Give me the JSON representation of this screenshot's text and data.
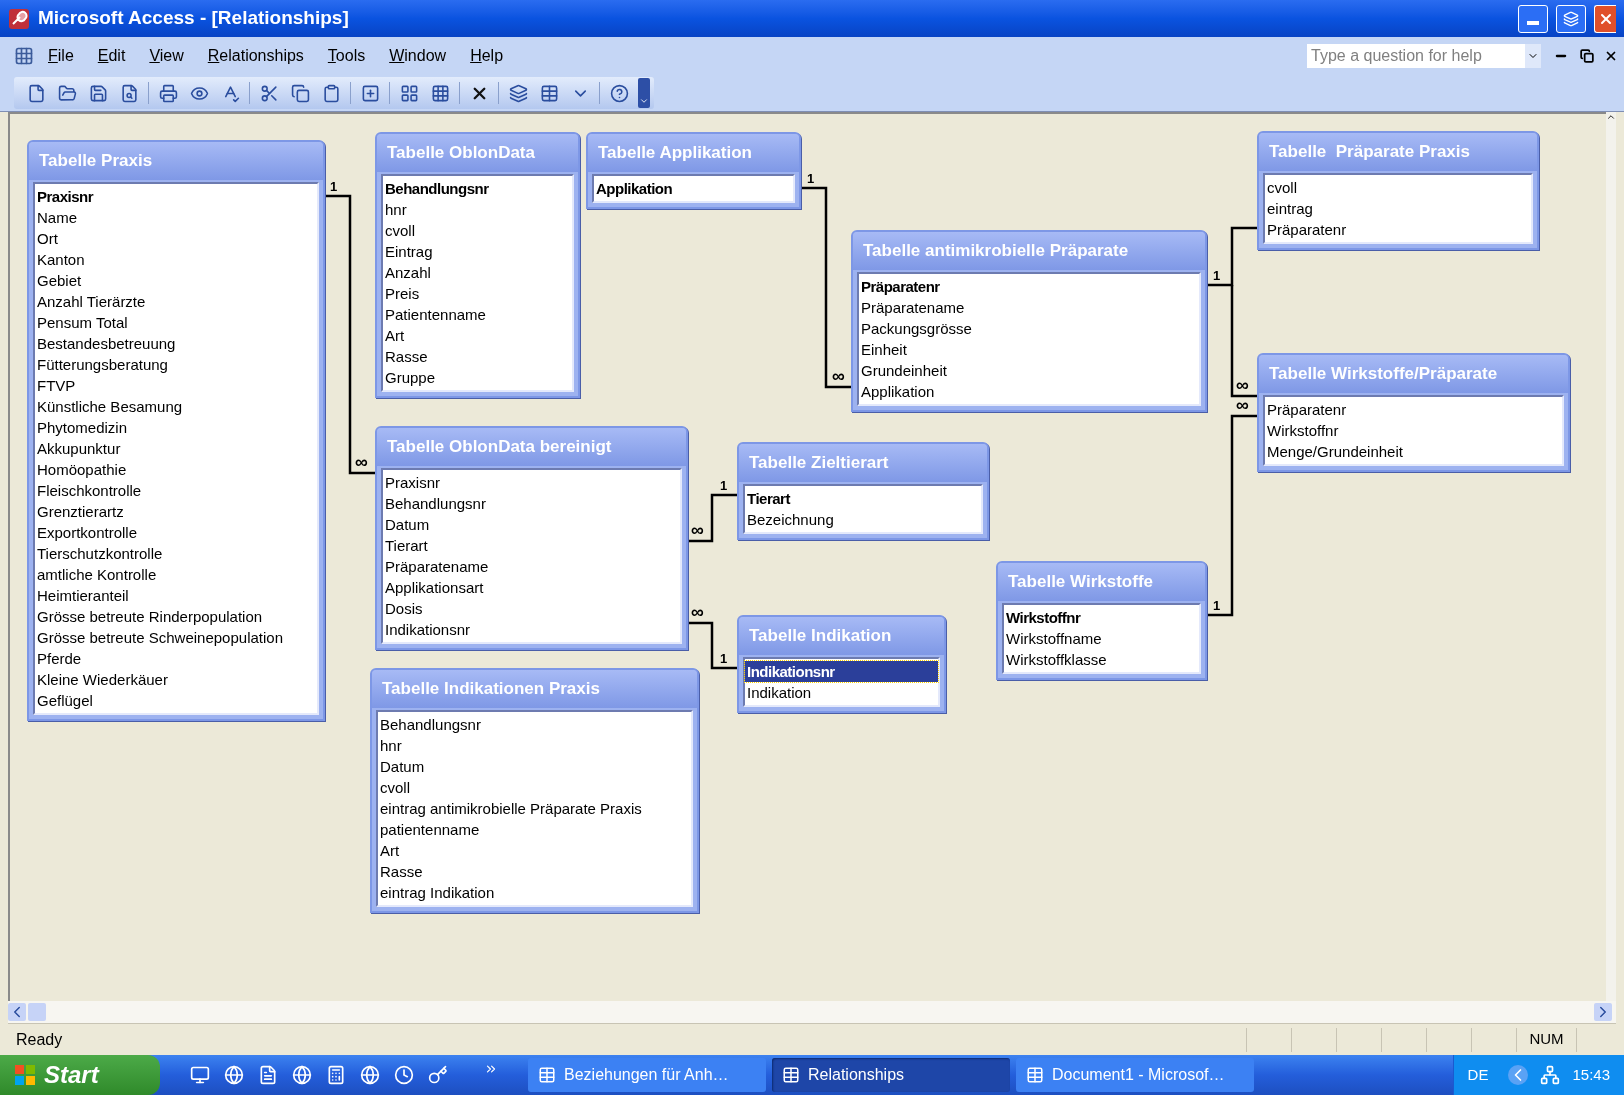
{
  "window": {
    "title": "Microsoft Access - [Relationships]"
  },
  "menu": [
    {
      "label": "File"
    },
    {
      "label": "Edit"
    },
    {
      "label": "View"
    },
    {
      "label": "Relationships"
    },
    {
      "label": "Tools"
    },
    {
      "label": "Window"
    },
    {
      "label": "Help"
    }
  ],
  "help_box": {
    "placeholder": "Type a question for help"
  },
  "tables": [
    {
      "title": "Tabelle Praxis",
      "fields": [
        {
          "name": "Praxisnr",
          "key": true,
          "selected": false
        },
        {
          "name": "Name",
          "key": false,
          "selected": false
        },
        {
          "name": "Ort",
          "key": false,
          "selected": false
        },
        {
          "name": "Kanton",
          "key": false,
          "selected": false
        },
        {
          "name": "Gebiet",
          "key": false,
          "selected": false
        },
        {
          "name": "Anzahl Tierärzte",
          "key": false,
          "selected": false
        },
        {
          "name": "Pensum Total",
          "key": false,
          "selected": false
        },
        {
          "name": "Bestandesbetreuung",
          "key": false,
          "selected": false
        },
        {
          "name": "Fütterungsberatung",
          "key": false,
          "selected": false
        },
        {
          "name": "FTVP",
          "key": false,
          "selected": false
        },
        {
          "name": "Künstliche Besamung",
          "key": false,
          "selected": false
        },
        {
          "name": "Phytomedizin",
          "key": false,
          "selected": false
        },
        {
          "name": "Akkupunktur",
          "key": false,
          "selected": false
        },
        {
          "name": "Homöopathie",
          "key": false,
          "selected": false
        },
        {
          "name": "Fleischkontrolle",
          "key": false,
          "selected": false
        },
        {
          "name": "Grenztierartz",
          "key": false,
          "selected": false
        },
        {
          "name": "Exportkontrolle",
          "key": false,
          "selected": false
        },
        {
          "name": "Tierschutzkontrolle",
          "key": false,
          "selected": false
        },
        {
          "name": "amtliche Kontrolle",
          "key": false,
          "selected": false
        },
        {
          "name": "Heimtieranteil",
          "key": false,
          "selected": false
        },
        {
          "name": "Grösse betreute Rinderpopulation",
          "key": false,
          "selected": false
        },
        {
          "name": "Grösse betreute Schweinepopulation",
          "key": false,
          "selected": false
        },
        {
          "name": "Pferde",
          "key": false,
          "selected": false
        },
        {
          "name": "Kleine Wiederkäuer",
          "key": false,
          "selected": false
        },
        {
          "name": "Geflügel",
          "key": false,
          "selected": false
        }
      ]
    },
    {
      "title": "Tabelle OblonData",
      "fields": [
        {
          "name": "Behandlungsnr",
          "key": true,
          "selected": false
        },
        {
          "name": "hnr",
          "key": false,
          "selected": false
        },
        {
          "name": "cvoll",
          "key": false,
          "selected": false
        },
        {
          "name": "Eintrag",
          "key": false,
          "selected": false
        },
        {
          "name": "Anzahl",
          "key": false,
          "selected": false
        },
        {
          "name": "Preis",
          "key": false,
          "selected": false
        },
        {
          "name": "Patientenname",
          "key": false,
          "selected": false
        },
        {
          "name": "Art",
          "key": false,
          "selected": false
        },
        {
          "name": "Rasse",
          "key": false,
          "selected": false
        },
        {
          "name": "Gruppe",
          "key": false,
          "selected": false
        }
      ]
    },
    {
      "title": "Tabelle Applikation",
      "fields": [
        {
          "name": "Applikation",
          "key": true,
          "selected": false
        }
      ]
    },
    {
      "title": "Tabelle  Präparate Praxis",
      "fields": [
        {
          "name": "cvoll",
          "key": false,
          "selected": false
        },
        {
          "name": "eintrag",
          "key": false,
          "selected": false
        },
        {
          "name": "Präparatenr",
          "key": false,
          "selected": false
        }
      ]
    },
    {
      "title": "Tabelle antimikrobielle Präparate",
      "fields": [
        {
          "name": "Präparatenr",
          "key": true,
          "selected": false
        },
        {
          "name": "Präparatename",
          "key": false,
          "selected": false
        },
        {
          "name": "Packungsgrösse",
          "key": false,
          "selected": false
        },
        {
          "name": "Einheit",
          "key": false,
          "selected": false
        },
        {
          "name": "Grundeinheit",
          "key": false,
          "selected": false
        },
        {
          "name": "Applikation",
          "key": false,
          "selected": false
        }
      ]
    },
    {
      "title": "Tabelle OblonData bereinigt",
      "fields": [
        {
          "name": "Praxisnr",
          "key": false,
          "selected": false
        },
        {
          "name": "Behandlungsnr",
          "key": false,
          "selected": false
        },
        {
          "name": "Datum",
          "key": false,
          "selected": false
        },
        {
          "name": "Tierart",
          "key": false,
          "selected": false
        },
        {
          "name": "Präparatename",
          "key": false,
          "selected": false
        },
        {
          "name": "Applikationsart",
          "key": false,
          "selected": false
        },
        {
          "name": "Dosis",
          "key": false,
          "selected": false
        },
        {
          "name": "Indikationsnr",
          "key": false,
          "selected": false
        }
      ]
    },
    {
      "title": "Tabelle Zieltierart",
      "fields": [
        {
          "name": "Tierart",
          "key": true,
          "selected": false
        },
        {
          "name": "Bezeichnung",
          "key": false,
          "selected": false
        }
      ]
    },
    {
      "title": "Tabelle Wirkstoffe/Präparate",
      "fields": [
        {
          "name": "Präparatenr",
          "key": false,
          "selected": false
        },
        {
          "name": "Wirkstoffnr",
          "key": false,
          "selected": false
        },
        {
          "name": "Menge/Grundeinheit",
          "key": false,
          "selected": false
        }
      ]
    },
    {
      "title": "Tabelle Wirkstoffe",
      "fields": [
        {
          "name": "Wirkstoffnr",
          "key": true,
          "selected": false
        },
        {
          "name": "Wirkstoffname",
          "key": false,
          "selected": false
        },
        {
          "name": "Wirkstoffklasse",
          "key": false,
          "selected": false
        }
      ]
    },
    {
      "title": "Tabelle Indikation",
      "fields": [
        {
          "name": "Indikationsnr",
          "key": true,
          "selected": true
        },
        {
          "name": "Indikation",
          "key": false,
          "selected": false
        }
      ]
    },
    {
      "title": "Tabelle Indikationen Praxis",
      "fields": [
        {
          "name": "Behandlungsnr",
          "key": false,
          "selected": false
        },
        {
          "name": "hnr",
          "key": false,
          "selected": false
        },
        {
          "name": "Datum",
          "key": false,
          "selected": false
        },
        {
          "name": "cvoll",
          "key": false,
          "selected": false
        },
        {
          "name": "eintrag antimikrobielle Präparate Praxis",
          "key": false,
          "selected": false
        },
        {
          "name": "patientenname",
          "key": false,
          "selected": false
        },
        {
          "name": "Art",
          "key": false,
          "selected": false
        },
        {
          "name": "Rasse",
          "key": false,
          "selected": false
        },
        {
          "name": "eintrag Indikation",
          "key": false,
          "selected": false
        }
      ]
    }
  ],
  "relationships": [
    {
      "labels": [
        "1",
        "∞"
      ]
    },
    {
      "labels": [
        "∞",
        "1"
      ]
    },
    {
      "labels": [
        "∞",
        "1"
      ]
    },
    {
      "labels": [
        "1",
        "∞"
      ]
    },
    {
      "labels": [
        "1"
      ]
    },
    {
      "labels": [
        "∞"
      ]
    },
    {
      "labels": [
        "1",
        "∞"
      ]
    }
  ],
  "status_bar": {
    "message": "Ready",
    "indicator": "NUM"
  },
  "taskbar": {
    "start": "Start",
    "tasks": [
      {
        "label": "Beziehungen für Anh…",
        "selected": false
      },
      {
        "label": "Relationships",
        "selected": true
      },
      {
        "label": "Document1 - Microsof…",
        "selected": false
      }
    ],
    "language": "DE",
    "clock": "15:43"
  }
}
